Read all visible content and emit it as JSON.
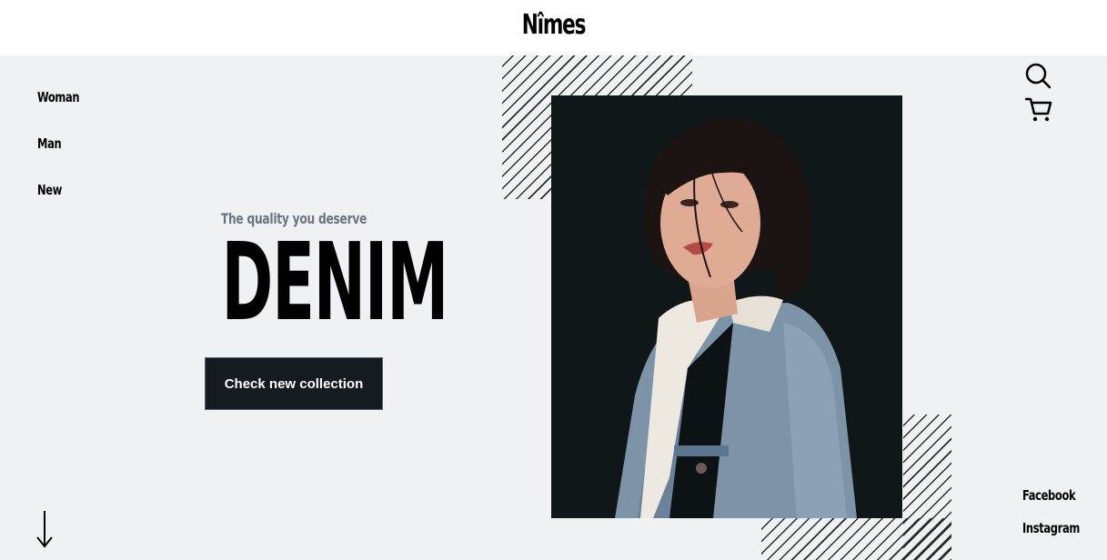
{
  "header": {
    "logo": "Nîmes"
  },
  "nav": {
    "items": [
      {
        "label": "Woman"
      },
      {
        "label": "Man"
      },
      {
        "label": "New"
      }
    ]
  },
  "hero": {
    "tagline": "The quality you deserve",
    "headline": "DENIM",
    "cta_label": "Check new collection"
  },
  "icons": {
    "search": "search-icon",
    "cart": "cart-icon",
    "scroll": "arrow-down-icon"
  },
  "social": {
    "items": [
      {
        "label": "Facebook"
      },
      {
        "label": "Instagram"
      }
    ]
  },
  "colors": {
    "background": "#f0f1f3",
    "header": "#ffffff",
    "button": "#161b22",
    "tagline": "#6b7280",
    "photo_bg": "#0f1718"
  }
}
